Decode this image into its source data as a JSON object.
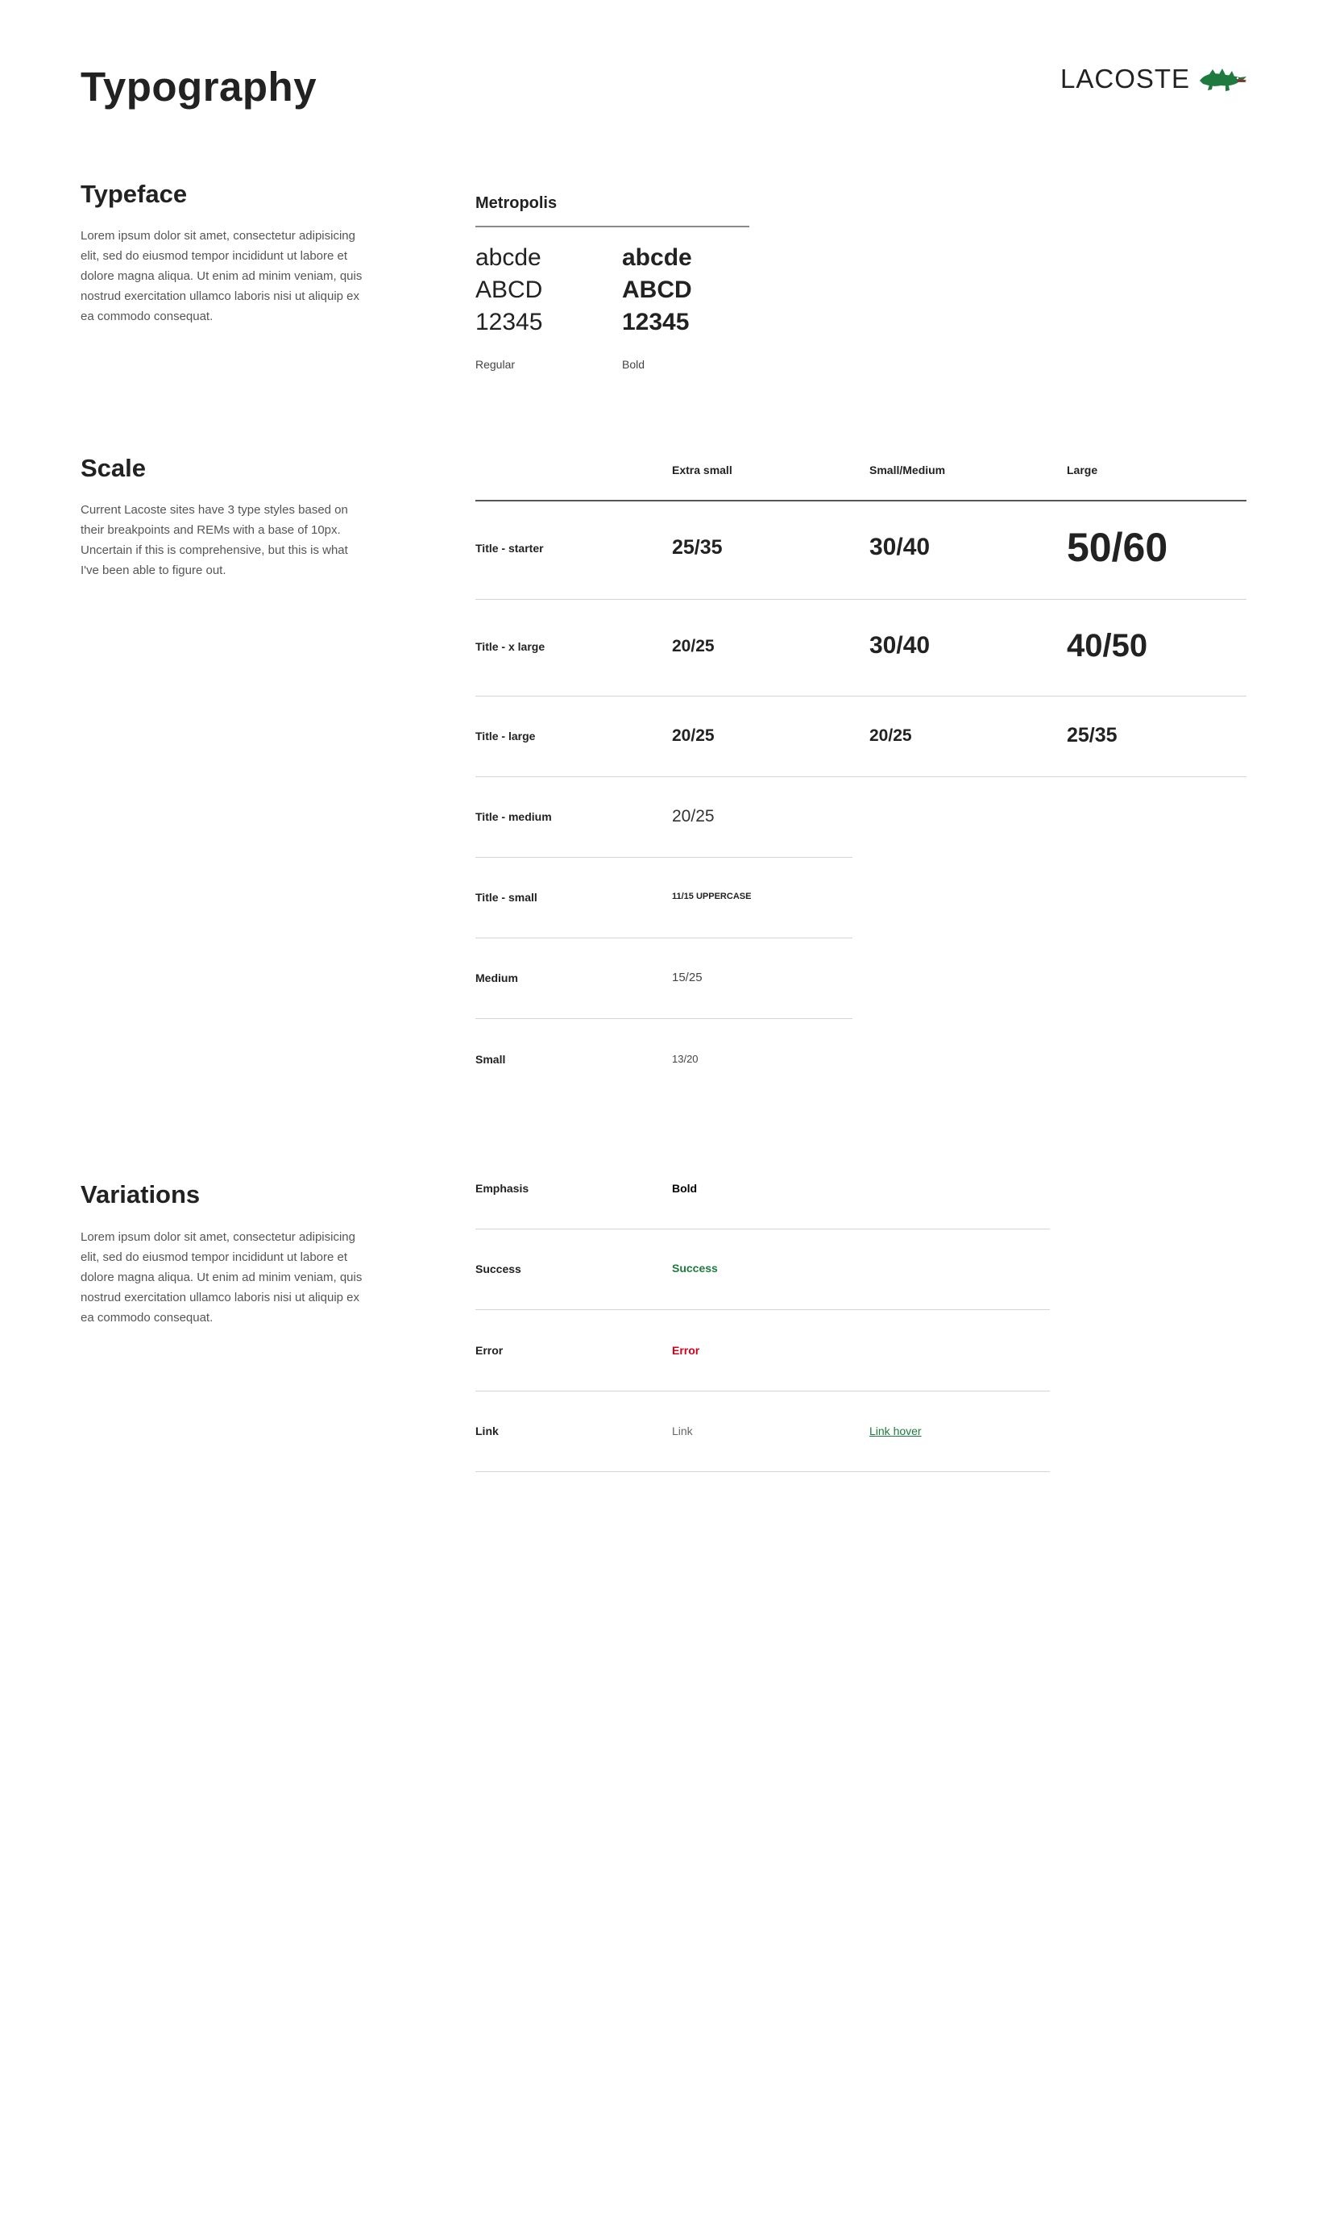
{
  "page": {
    "title": "Typography"
  },
  "logo": {
    "text": "LACOSTE",
    "icon": "crocodile-icon",
    "color": "#1e7a3f"
  },
  "typeface": {
    "title": "Typeface",
    "description": "Lorem ipsum dolor sit amet, consectetur adipisicing elit, sed do eiusmod tempor incididunt ut labore et dolore magna aliqua. Ut enim ad minim veniam, quis nostrud exercitation ullamco laboris nisi ut aliquip ex ea commodo consequat.",
    "font_name": "Metropolis",
    "samples_regular": [
      "abcde",
      "ABCD",
      "12345"
    ],
    "samples_bold": [
      "abcde",
      "ABCD",
      "12345"
    ],
    "regular_label": "Regular",
    "bold_label": "Bold"
  },
  "scale": {
    "title": "Scale",
    "description": "Current Lacoste sites have 3 type styles based on their breakpoints and REMs with a base of 10px.  Uncertain if this is comprehensive, but this is what I've been able to figure out.",
    "columns": [
      "Extra small",
      "Small/Medium",
      "Large"
    ],
    "rows": [
      {
        "label": "Title - starter",
        "values": [
          "25/35",
          "30/40",
          "50/60"
        ]
      },
      {
        "label": "Title - x large",
        "values": [
          "20/25",
          "30/40",
          "40/50"
        ]
      },
      {
        "label": "Title - large",
        "values": [
          "20/25",
          "20/25",
          "25/35"
        ]
      },
      {
        "label": "Title - medium",
        "values": [
          "20/25"
        ]
      },
      {
        "label": "Title - small",
        "values": [
          "11/15 UPPERCASE"
        ]
      },
      {
        "label": "Medium",
        "values": [
          "15/25"
        ]
      },
      {
        "label": "Small",
        "values": [
          "13/20"
        ]
      }
    ]
  },
  "variations": {
    "title": "Variations",
    "description": "Lorem ipsum dolor sit amet, consectetur adipisicing elit, sed do eiusmod tempor incididunt ut labore et dolore magna aliqua. Ut enim ad minim veniam, quis nostrud exercitation ullamco laboris nisi ut aliquip ex ea commodo consequat.",
    "rows": [
      {
        "label": "Emphasis",
        "value": "Bold"
      },
      {
        "label": "Success",
        "value": "Success"
      },
      {
        "label": "Error",
        "value": "Error"
      },
      {
        "label": "Link",
        "value": "Link",
        "hover_value": "Link hover"
      }
    ],
    "colors": {
      "success": "#1e7a3f",
      "error": "#d0021b",
      "link": "#666666",
      "link_hover": "#1e7a3f"
    }
  }
}
